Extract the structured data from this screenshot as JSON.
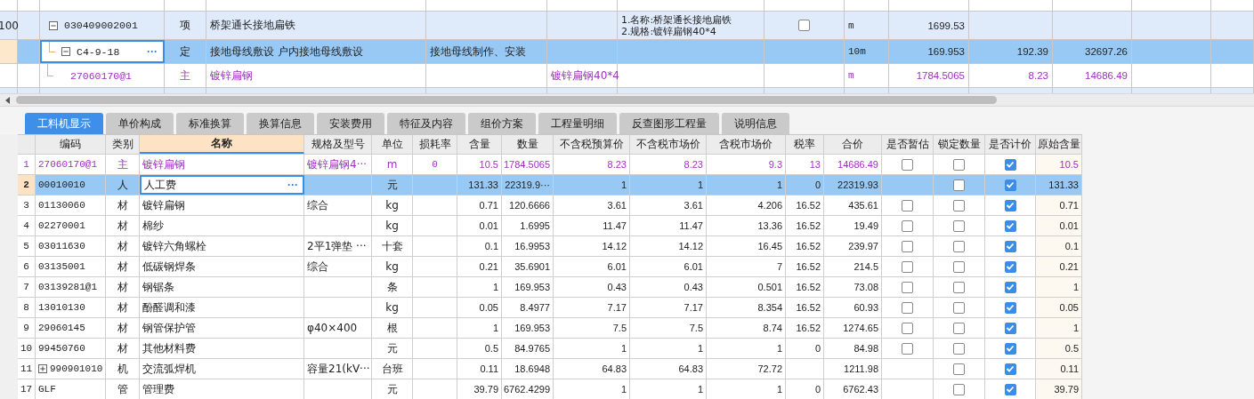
{
  "top_grid": {
    "rows": [
      {
        "number": "100",
        "code": "030409002001",
        "type": "项",
        "name": "桥架通长接地扁铁",
        "description": [
          "1.名称:桥架通长接地扁铁",
          "2.规格:镀锌扁钢40*4"
        ],
        "checked": false,
        "unit": "m",
        "quantity": "1699.53",
        "expanded": true,
        "selected": false,
        "kind": "item",
        "children": [
          {
            "code": "C4-9-18",
            "type": "定",
            "name": "接地母线敷设 户内接地母线敷设",
            "content": "接地母线制作、安装",
            "unit": "10m",
            "quantity": "169.953",
            "price": "192.39",
            "total": "32697.26",
            "expanded": true,
            "selected": true,
            "edit_button": "···",
            "children": [
              {
                "code": "27060170@1",
                "type": "主",
                "name": "镀锌扁钢",
                "spec": "镀锌扁钢40*4",
                "unit": "m",
                "quantity": "1784.5065",
                "price": "8.23",
                "total": "14686.49",
                "selected": false,
                "kind": "main"
              }
            ]
          }
        ]
      }
    ]
  },
  "tabs": [
    {
      "label": "工料机显示",
      "selected": true
    },
    {
      "label": "单价构成",
      "selected": false
    },
    {
      "label": "标准换算",
      "selected": false
    },
    {
      "label": "换算信息",
      "selected": false
    },
    {
      "label": "安装费用",
      "selected": false
    },
    {
      "label": "特征及内容",
      "selected": false
    },
    {
      "label": "组价方案",
      "selected": false
    },
    {
      "label": "工程量明细",
      "selected": false
    },
    {
      "label": "反查图形工程量",
      "selected": false
    },
    {
      "label": "说明信息",
      "selected": false
    }
  ],
  "detail_grid": {
    "columns": [
      {
        "label": "编码",
        "selected": false
      },
      {
        "label": "类别",
        "selected": false
      },
      {
        "label": "名称",
        "selected": true
      },
      {
        "label": "规格及型号",
        "selected": false
      },
      {
        "label": "单位",
        "selected": false
      },
      {
        "label": "损耗率",
        "selected": false
      },
      {
        "label": "含量",
        "selected": false
      },
      {
        "label": "数量",
        "selected": false
      },
      {
        "label": "不含税预算价",
        "selected": false
      },
      {
        "label": "不含税市场价",
        "selected": false
      },
      {
        "label": "含税市场价",
        "selected": false
      },
      {
        "label": "税率",
        "selected": false
      },
      {
        "label": "合价",
        "selected": false
      },
      {
        "label": "是否暂估",
        "selected": false
      },
      {
        "label": "锁定数量",
        "selected": false
      },
      {
        "label": "是否计价",
        "selected": false
      },
      {
        "label": "原始含量",
        "selected": false
      }
    ],
    "rows": [
      {
        "number": "1",
        "code": "27060170@1",
        "type": "主",
        "name": "镀锌扁钢",
        "spec": "镀锌扁钢4···",
        "unit": "m",
        "loss": "0",
        "content": "10.5",
        "qty": "1784.5065",
        "budget": "8.23",
        "market": "8.23",
        "market_tax": "9.3",
        "tax": "13",
        "total": "14686.49",
        "estimate": false,
        "locked": false,
        "priced": true,
        "original": "10.5",
        "kind": "main",
        "selected": false
      },
      {
        "number": "2",
        "code": "00010010",
        "type": "人",
        "name": "人工费",
        "edit_button": "···",
        "unit": "元",
        "content": "131.33",
        "qty": "22319.9···",
        "budget": "1",
        "market": "1",
        "market_tax": "1",
        "tax": "0",
        "total": "22319.93",
        "locked": false,
        "priced": true,
        "original": "131.33",
        "kind": "normal",
        "selected": true
      },
      {
        "number": "3",
        "code": "01130060",
        "type": "材",
        "name": "镀锌扁钢",
        "spec": "综合",
        "unit": "kg",
        "content": "0.71",
        "qty": "120.6666",
        "budget": "3.61",
        "market": "3.61",
        "market_tax": "4.206",
        "tax": "16.52",
        "total": "435.61",
        "estimate": false,
        "locked": false,
        "priced": true,
        "original": "0.71",
        "kind": "normal",
        "selected": false
      },
      {
        "number": "4",
        "code": "02270001",
        "type": "材",
        "name": "棉纱",
        "unit": "kg",
        "content": "0.01",
        "qty": "1.6995",
        "budget": "11.47",
        "market": "11.47",
        "market_tax": "13.36",
        "tax": "16.52",
        "total": "19.49",
        "estimate": false,
        "locked": false,
        "priced": true,
        "original": "0.01",
        "kind": "normal",
        "selected": false
      },
      {
        "number": "5",
        "code": "03011630",
        "type": "材",
        "name": "镀锌六角螺栓",
        "spec": "2平1弹垫 ···",
        "unit": "十套",
        "content": "0.1",
        "qty": "16.9953",
        "budget": "14.12",
        "market": "14.12",
        "market_tax": "16.45",
        "tax": "16.52",
        "total": "239.97",
        "estimate": false,
        "locked": false,
        "priced": true,
        "original": "0.1",
        "kind": "normal",
        "selected": false
      },
      {
        "number": "6",
        "code": "03135001",
        "type": "材",
        "name": "低碳钢焊条",
        "spec": "综合",
        "unit": "kg",
        "content": "0.21",
        "qty": "35.6901",
        "budget": "6.01",
        "market": "6.01",
        "market_tax": "7",
        "tax": "16.52",
        "total": "214.5",
        "estimate": false,
        "locked": false,
        "priced": true,
        "original": "0.21",
        "kind": "normal",
        "selected": false
      },
      {
        "number": "7",
        "code": "03139281@1",
        "type": "材",
        "name": "钢锯条",
        "unit": "条",
        "content": "1",
        "qty": "169.953",
        "budget": "0.43",
        "market": "0.43",
        "market_tax": "0.501",
        "tax": "16.52",
        "total": "73.08",
        "estimate": false,
        "locked": false,
        "priced": true,
        "original": "1",
        "kind": "normal",
        "selected": false
      },
      {
        "number": "8",
        "code": "13010130",
        "type": "材",
        "name": "酚醛调和漆",
        "unit": "kg",
        "content": "0.05",
        "qty": "8.4977",
        "budget": "7.17",
        "market": "7.17",
        "market_tax": "8.354",
        "tax": "16.52",
        "total": "60.93",
        "estimate": false,
        "locked": false,
        "priced": true,
        "original": "0.05",
        "kind": "normal",
        "selected": false
      },
      {
        "number": "9",
        "code": "29060145",
        "type": "材",
        "name": "钢管保护管",
        "spec": "φ40×400",
        "unit": "根",
        "content": "1",
        "qty": "169.953",
        "budget": "7.5",
        "market": "7.5",
        "market_tax": "8.74",
        "tax": "16.52",
        "total": "1274.65",
        "estimate": false,
        "locked": false,
        "priced": true,
        "original": "1",
        "kind": "normal",
        "selected": false
      },
      {
        "number": "10",
        "code": "99450760",
        "type": "材",
        "name": "其他材料费",
        "unit": "元",
        "content": "0.5",
        "qty": "84.9765",
        "budget": "1",
        "market": "1",
        "market_tax": "1",
        "tax": "0",
        "total": "84.98",
        "estimate": false,
        "locked": false,
        "priced": true,
        "original": "0.5",
        "kind": "normal",
        "selected": false
      },
      {
        "number": "11",
        "code": "990901010",
        "expanded": false,
        "type": "机",
        "name": "交流弧焊机",
        "spec": "容量21(kV···",
        "unit": "台班",
        "content": "0.11",
        "qty": "18.6948",
        "budget": "64.83",
        "market": "64.83",
        "market_tax": "72.72",
        "total": "1211.98",
        "locked": false,
        "priced": true,
        "original": "0.11",
        "kind": "normal",
        "selected": false
      },
      {
        "number": "17",
        "code": "GLF",
        "type": "管",
        "name": "管理费",
        "unit": "元",
        "content": "39.79",
        "qty": "6762.4299",
        "budget": "1",
        "market": "1",
        "market_tax": "1",
        "tax": "0",
        "total": "6762.43",
        "locked": false,
        "priced": true,
        "original": "39.79",
        "kind": "normal",
        "selected": false
      }
    ]
  }
}
